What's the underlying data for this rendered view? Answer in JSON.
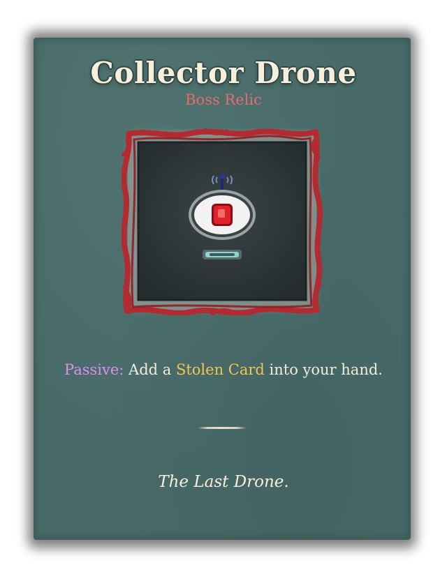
{
  "relic": {
    "name": "Collector Drone",
    "rarity": "Boss Relic",
    "image_icon": "collector-drone-icon",
    "description": {
      "prefix": "Passive:",
      "text_before": " Add a ",
      "keyword": "Stolen Card",
      "text_after": " into your hand."
    },
    "flavor_text": "The Last Drone."
  },
  "colors": {
    "card_background": "#476a68",
    "title": "#f7efd9",
    "rarity": "#e36f6b",
    "passive_keyword": "#dd8ef0",
    "card_keyword": "#efc851",
    "frame": "#b12b31"
  }
}
